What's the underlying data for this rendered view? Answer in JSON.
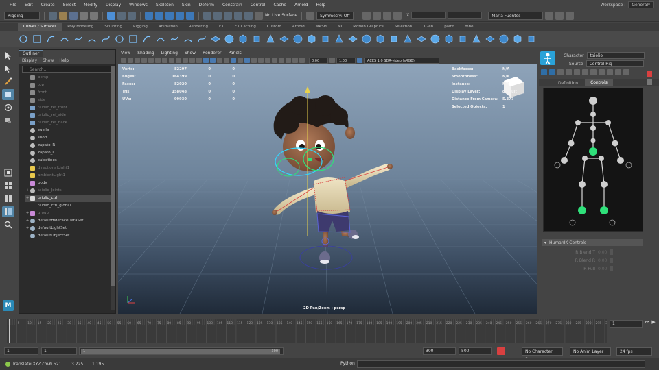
{
  "menubar": {
    "items": [
      "File",
      "Edit",
      "Create",
      "Select",
      "Modify",
      "Display",
      "Windows",
      "Skeleton",
      "Skin",
      "Deform",
      "Constrain",
      "Control",
      "Cache",
      "Arnold",
      "Help"
    ],
    "workspace_label": "Workspace :",
    "workspace_value": "General*"
  },
  "statusline": {
    "mode": "Rigging",
    "live_surface": "No Live Surface",
    "symmetry": "Symmetry: Off",
    "x_label": "X",
    "user": "Maria Fuentes"
  },
  "shelf": {
    "tabs": [
      "Curves / Surfaces",
      "Poly Modeling",
      "Sculpting",
      "Rigging",
      "Animation",
      "Rendering",
      "FX",
      "FX Caching",
      "Custom",
      "Arnold",
      "MASH",
      "MI",
      "Motion Graphics",
      "Selection",
      "XGen",
      "paint",
      "mbel"
    ],
    "active_tab": "Curves / Surfaces"
  },
  "outliner": {
    "title": "Outliner",
    "menu": [
      "Display",
      "Show",
      "Help"
    ],
    "search_placeholder": "Search...",
    "items": [
      {
        "label": "persp",
        "style": "dim",
        "icon": "camera"
      },
      {
        "label": "top",
        "style": "dim",
        "icon": "camera"
      },
      {
        "label": "front",
        "style": "dim",
        "icon": "camera"
      },
      {
        "label": "side",
        "style": "dim",
        "icon": "camera"
      },
      {
        "label": "taiolio_ref_front",
        "style": "dim",
        "icon": "imageplane"
      },
      {
        "label": "taiolio_ref_side",
        "style": "dim",
        "icon": "imageplane"
      },
      {
        "label": "taiolio_ref_back",
        "style": "dim",
        "icon": "imageplane"
      },
      {
        "label": "cuello",
        "style": "",
        "icon": "joint"
      },
      {
        "label": "short",
        "style": "",
        "icon": "joint"
      },
      {
        "label": "zapato_R",
        "style": "",
        "icon": "joint"
      },
      {
        "label": "zapato_L",
        "style": "",
        "icon": "joint"
      },
      {
        "label": "calcetines",
        "style": "",
        "icon": "joint"
      },
      {
        "label": "directionalLight1",
        "style": "dim",
        "icon": "light"
      },
      {
        "label": "ambientLight1",
        "style": "dim",
        "icon": "light"
      },
      {
        "label": "body",
        "style": "",
        "icon": "mesh"
      },
      {
        "label": "taiolio_Joints",
        "style": "dim",
        "icon": "joint",
        "exp": "+"
      },
      {
        "label": "taiolio_ctrl",
        "style": "sel",
        "icon": "ctrl",
        "exp": "+"
      },
      {
        "label": "taiolio_ctrl_global",
        "style": "",
        "icon": "none"
      },
      {
        "label": "group",
        "style": "dim",
        "icon": "mesh",
        "exp": "+"
      },
      {
        "label": "defaultHideFaceDataSet",
        "style": "",
        "icon": "set",
        "exp": "+"
      },
      {
        "label": "defaultLightSet",
        "style": "",
        "icon": "set",
        "exp": "+"
      },
      {
        "label": "defaultObjectSet",
        "style": "",
        "icon": "set"
      }
    ]
  },
  "viewport": {
    "menu": [
      "View",
      "Shading",
      "Lighting",
      "Show",
      "Renderer",
      "Panels"
    ],
    "field1": "0.00",
    "field2": "1.00",
    "colorspace": "ACES 1.0 SDR-video (sRGB)",
    "hud_left": [
      {
        "label": "Verts:",
        "v1": "82297",
        "v2": "0",
        "v3": "0"
      },
      {
        "label": "Edges:",
        "v1": "164399",
        "v2": "0",
        "v3": "0"
      },
      {
        "label": "Faces:",
        "v1": "82020",
        "v2": "0",
        "v3": "0"
      },
      {
        "label": "Tris:",
        "v1": "158048",
        "v2": "0",
        "v3": "0"
      },
      {
        "label": "UVs:",
        "v1": "99930",
        "v2": "0",
        "v3": "0"
      }
    ],
    "hud_right": [
      {
        "label": "Backfaces:",
        "value": "N/A"
      },
      {
        "label": "Smoothness:",
        "value": "N/A"
      },
      {
        "label": "Instance:",
        "value": "N/A"
      },
      {
        "label": "Display Layer:",
        "value": "default"
      },
      {
        "label": "Distance From Camera:",
        "value": "5.377"
      },
      {
        "label": "Selected Objects:",
        "value": "1"
      }
    ],
    "cam_label": "2D Pan/Zoom : persp"
  },
  "hik": {
    "character_label": "Character",
    "character_value": "taiolio",
    "source_label": "Source",
    "source_value": "Control Rig",
    "tabs": [
      "Definition",
      "Controls"
    ],
    "active_tab": "Controls",
    "section_title": "HumanIK Controls",
    "params": [
      {
        "label": "R Blend T",
        "value": "0.00"
      },
      {
        "label": "R Blend R",
        "value": "0.00"
      },
      {
        "label": "R Pull",
        "value": "0.00"
      }
    ]
  },
  "timeline": {
    "ticks": [
      "5",
      "10",
      "15",
      "20",
      "25",
      "30",
      "35",
      "40",
      "45",
      "50",
      "55",
      "60",
      "65",
      "70",
      "75",
      "80",
      "85",
      "90",
      "95",
      "100",
      "105",
      "110",
      "115",
      "120",
      "125",
      "130",
      "135",
      "140",
      "145",
      "150",
      "155",
      "160",
      "165",
      "170",
      "175",
      "180",
      "185",
      "190",
      "195",
      "200",
      "205",
      "210",
      "215",
      "220",
      "225",
      "230",
      "235",
      "240",
      "245",
      "250",
      "255",
      "260",
      "265",
      "270",
      "275",
      "280",
      "285",
      "290",
      "295",
      "300"
    ],
    "current_frame": "1"
  },
  "range": {
    "start": "1",
    "inner_start": "1",
    "inner_end": "300",
    "end": "300",
    "max": "500",
    "character_set": "No Character Set",
    "anim_layer": "No Anim Layer",
    "fps": "24 fps"
  },
  "cmdline": {
    "result_label": "Translate(XYZ cm):",
    "x": "-0.521",
    "y": "3.225",
    "z": "1.195",
    "language": "Python"
  },
  "colors": {
    "accent": "#4d8fd6",
    "ctrl_green": "#2fe07a",
    "ctrl_ring": "#33d7ff",
    "selection_red": "#d94040"
  }
}
